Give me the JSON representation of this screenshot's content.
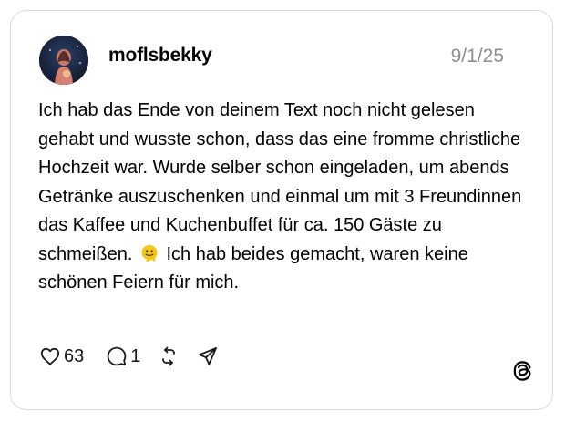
{
  "post": {
    "username": "moflsbekky",
    "date": "9/1/25",
    "text_before_emoji": "Ich hab das Ende von deinem Text noch nicht gelesen gehabt und wusste schon, dass das eine fromme christliche Hochzeit war. Wurde selber schon eingeladen, um abends Getränke auszuschenken und einmal um mit 3 Freundinnen das Kaffee und Kuchenbuffet für ca. 150 Gäste zu schmeißen.",
    "emoji": "melting-face-emoji",
    "text_after_emoji": "Ich hab beides gemacht, waren keine schönen Feiern für mich."
  },
  "actions": {
    "like_count": "63",
    "reply_count": "1"
  },
  "icons": {
    "like": "heart-icon",
    "reply": "comment-bubble-icon",
    "repost": "repost-icon",
    "share": "send-icon",
    "brand": "threads-logo-icon"
  },
  "colors": {
    "text": "#000000",
    "muted": "#8e8e8e",
    "border": "#d9d9d9",
    "emoji": "#f5c518"
  }
}
